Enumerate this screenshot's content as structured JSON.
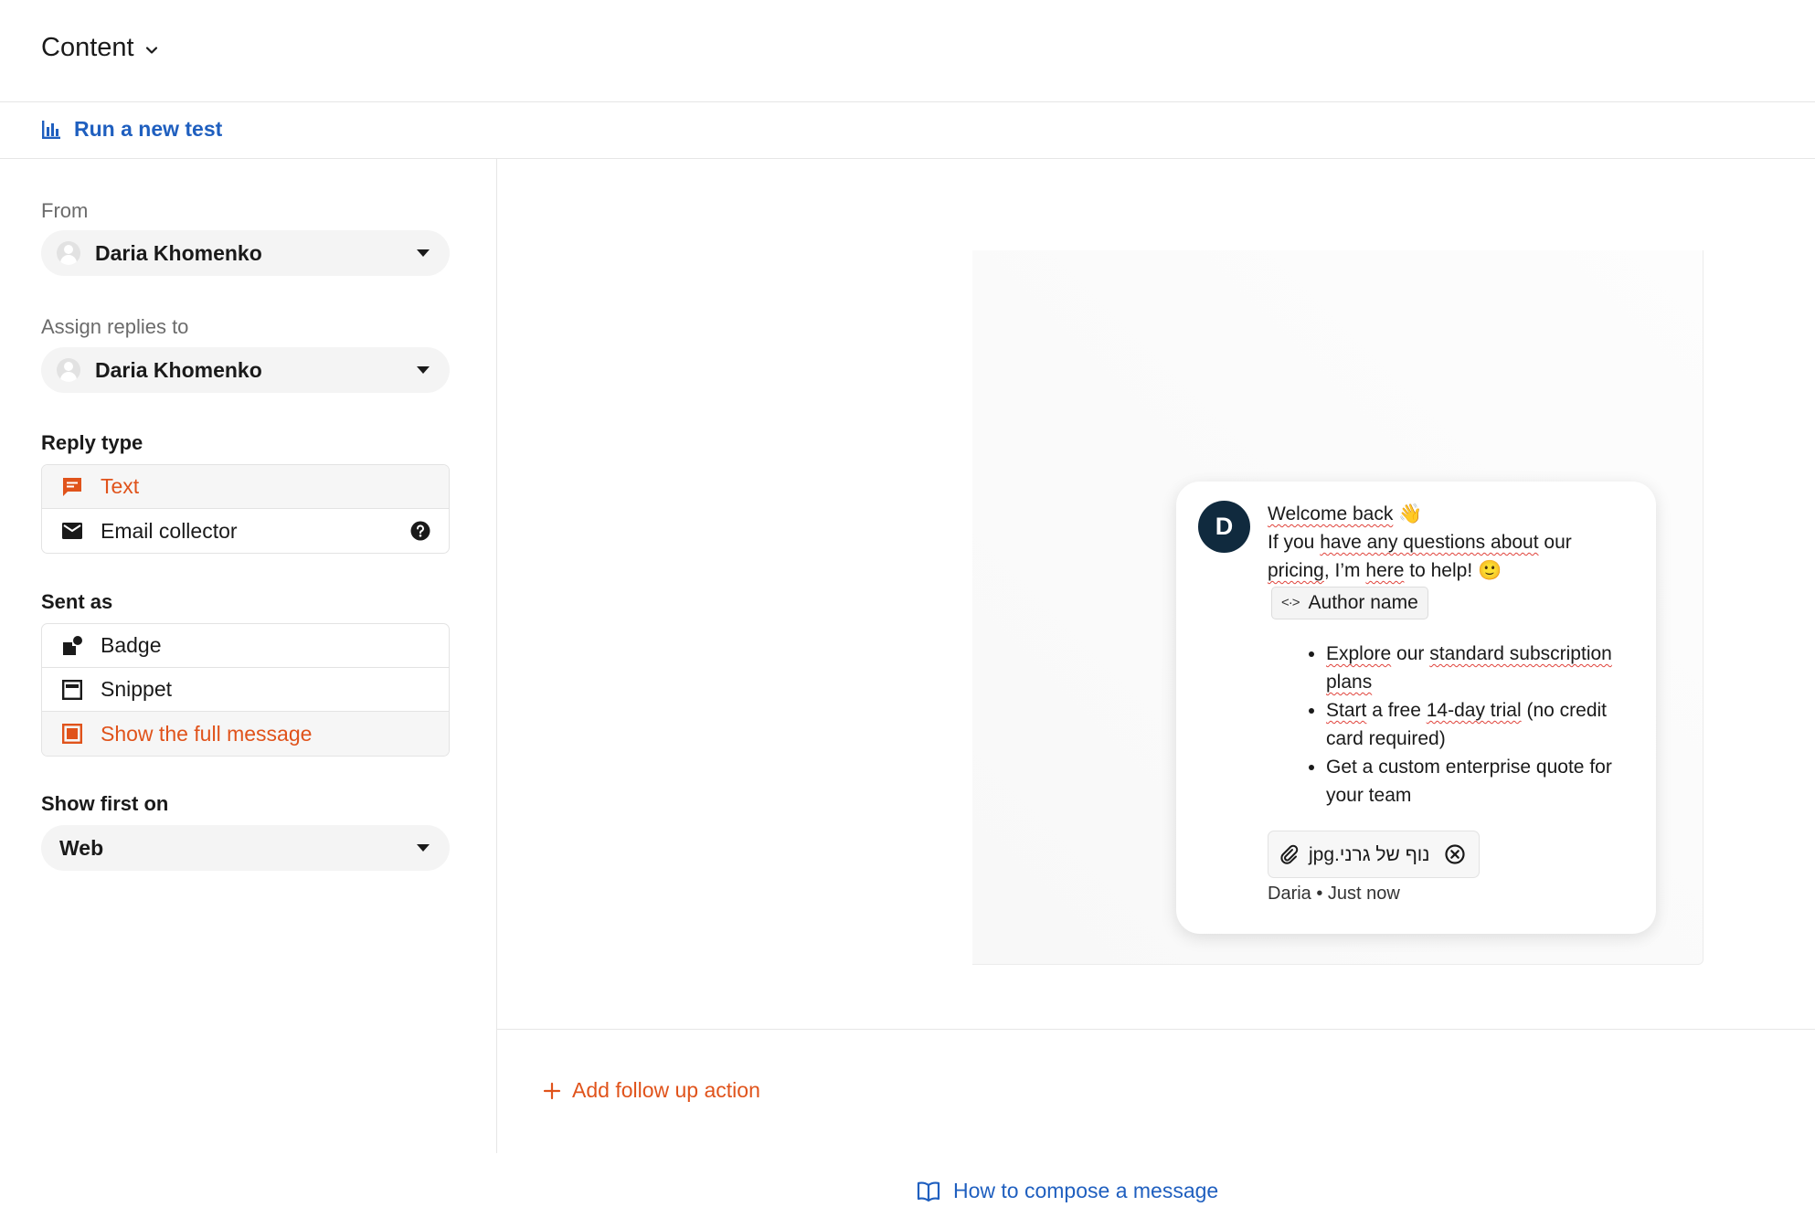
{
  "header": {
    "title": "Content",
    "title_icon": "chevron-down-icon"
  },
  "toolbar": {
    "run_test_label": "Run a new test",
    "run_test_icon": "bar-chart-icon"
  },
  "sidebar": {
    "from": {
      "label": "From",
      "value": "Daria Khomenko"
    },
    "assign": {
      "label": "Assign replies to",
      "value": "Daria Khomenko"
    },
    "reply_type": {
      "label": "Reply type",
      "options": [
        {
          "label": "Text",
          "icon": "message-icon",
          "active": true
        },
        {
          "label": "Email collector",
          "icon": "envelope-icon",
          "active": false
        }
      ]
    },
    "sent_as": {
      "label": "Sent as",
      "options": [
        {
          "label": "Badge",
          "icon": "badge-icon",
          "active": false
        },
        {
          "label": "Snippet",
          "icon": "snippet-icon",
          "active": false
        },
        {
          "label": "Show the full message",
          "icon": "full-message-icon",
          "active": true
        }
      ]
    },
    "show_first_on": {
      "label": "Show first on",
      "value": "Web"
    }
  },
  "preview": {
    "avatar_initial": "D",
    "greeting": "Welcome back",
    "greeting_emoji": "👋",
    "line2_a": "If you",
    "line2_b": "have any questions about",
    "line2_c": "our",
    "line3_a": "pricing",
    "line3_b": ", I’m",
    "line3_c": "here",
    "line3_d": "to help!",
    "line3_emoji": "🙂",
    "chip_code": "<·>",
    "chip_label": "Author name",
    "bullets": [
      {
        "a": "Explore",
        "b": " our ",
        "c": "standard subscription plans",
        "d": ""
      },
      {
        "a": "Start",
        "b": " a free ",
        "c": "14-day trial",
        "d": " (no credit card required)"
      },
      {
        "a": "",
        "b": "Get a custom enterprise quote for your team",
        "c": "",
        "d": ""
      }
    ],
    "attachment_name": "נוף של גרני.jpg",
    "meta": "Daria • Just now"
  },
  "followup_label": "Add follow up action",
  "howto_label": "How to compose a message",
  "colors": {
    "accent": "#e0531b",
    "link": "#1f5fbf",
    "avatar_bg": "#102a3e"
  }
}
